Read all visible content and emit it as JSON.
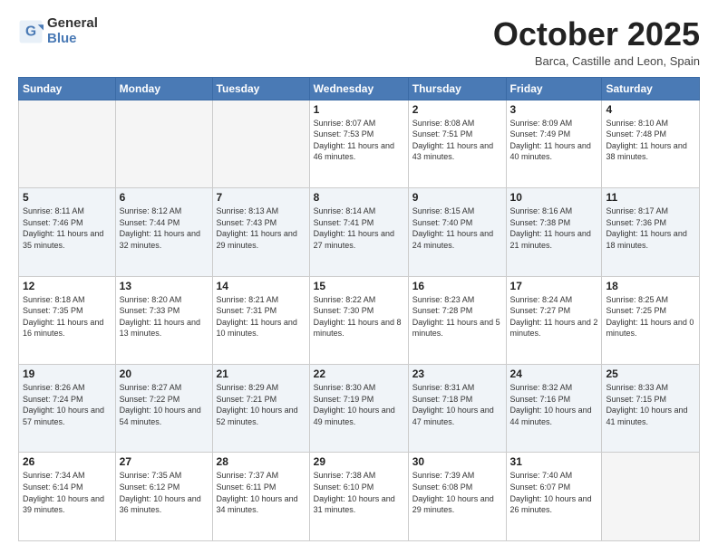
{
  "logo": {
    "general": "General",
    "blue": "Blue"
  },
  "title": "October 2025",
  "subtitle": "Barca, Castille and Leon, Spain",
  "headers": [
    "Sunday",
    "Monday",
    "Tuesday",
    "Wednesday",
    "Thursday",
    "Friday",
    "Saturday"
  ],
  "weeks": [
    [
      {
        "day": "",
        "info": ""
      },
      {
        "day": "",
        "info": ""
      },
      {
        "day": "",
        "info": ""
      },
      {
        "day": "1",
        "info": "Sunrise: 8:07 AM\nSunset: 7:53 PM\nDaylight: 11 hours and 46 minutes."
      },
      {
        "day": "2",
        "info": "Sunrise: 8:08 AM\nSunset: 7:51 PM\nDaylight: 11 hours and 43 minutes."
      },
      {
        "day": "3",
        "info": "Sunrise: 8:09 AM\nSunset: 7:49 PM\nDaylight: 11 hours and 40 minutes."
      },
      {
        "day": "4",
        "info": "Sunrise: 8:10 AM\nSunset: 7:48 PM\nDaylight: 11 hours and 38 minutes."
      }
    ],
    [
      {
        "day": "5",
        "info": "Sunrise: 8:11 AM\nSunset: 7:46 PM\nDaylight: 11 hours and 35 minutes."
      },
      {
        "day": "6",
        "info": "Sunrise: 8:12 AM\nSunset: 7:44 PM\nDaylight: 11 hours and 32 minutes."
      },
      {
        "day": "7",
        "info": "Sunrise: 8:13 AM\nSunset: 7:43 PM\nDaylight: 11 hours and 29 minutes."
      },
      {
        "day": "8",
        "info": "Sunrise: 8:14 AM\nSunset: 7:41 PM\nDaylight: 11 hours and 27 minutes."
      },
      {
        "day": "9",
        "info": "Sunrise: 8:15 AM\nSunset: 7:40 PM\nDaylight: 11 hours and 24 minutes."
      },
      {
        "day": "10",
        "info": "Sunrise: 8:16 AM\nSunset: 7:38 PM\nDaylight: 11 hours and 21 minutes."
      },
      {
        "day": "11",
        "info": "Sunrise: 8:17 AM\nSunset: 7:36 PM\nDaylight: 11 hours and 18 minutes."
      }
    ],
    [
      {
        "day": "12",
        "info": "Sunrise: 8:18 AM\nSunset: 7:35 PM\nDaylight: 11 hours and 16 minutes."
      },
      {
        "day": "13",
        "info": "Sunrise: 8:20 AM\nSunset: 7:33 PM\nDaylight: 11 hours and 13 minutes."
      },
      {
        "day": "14",
        "info": "Sunrise: 8:21 AM\nSunset: 7:31 PM\nDaylight: 11 hours and 10 minutes."
      },
      {
        "day": "15",
        "info": "Sunrise: 8:22 AM\nSunset: 7:30 PM\nDaylight: 11 hours and 8 minutes."
      },
      {
        "day": "16",
        "info": "Sunrise: 8:23 AM\nSunset: 7:28 PM\nDaylight: 11 hours and 5 minutes."
      },
      {
        "day": "17",
        "info": "Sunrise: 8:24 AM\nSunset: 7:27 PM\nDaylight: 11 hours and 2 minutes."
      },
      {
        "day": "18",
        "info": "Sunrise: 8:25 AM\nSunset: 7:25 PM\nDaylight: 11 hours and 0 minutes."
      }
    ],
    [
      {
        "day": "19",
        "info": "Sunrise: 8:26 AM\nSunset: 7:24 PM\nDaylight: 10 hours and 57 minutes."
      },
      {
        "day": "20",
        "info": "Sunrise: 8:27 AM\nSunset: 7:22 PM\nDaylight: 10 hours and 54 minutes."
      },
      {
        "day": "21",
        "info": "Sunrise: 8:29 AM\nSunset: 7:21 PM\nDaylight: 10 hours and 52 minutes."
      },
      {
        "day": "22",
        "info": "Sunrise: 8:30 AM\nSunset: 7:19 PM\nDaylight: 10 hours and 49 minutes."
      },
      {
        "day": "23",
        "info": "Sunrise: 8:31 AM\nSunset: 7:18 PM\nDaylight: 10 hours and 47 minutes."
      },
      {
        "day": "24",
        "info": "Sunrise: 8:32 AM\nSunset: 7:16 PM\nDaylight: 10 hours and 44 minutes."
      },
      {
        "day": "25",
        "info": "Sunrise: 8:33 AM\nSunset: 7:15 PM\nDaylight: 10 hours and 41 minutes."
      }
    ],
    [
      {
        "day": "26",
        "info": "Sunrise: 7:34 AM\nSunset: 6:14 PM\nDaylight: 10 hours and 39 minutes."
      },
      {
        "day": "27",
        "info": "Sunrise: 7:35 AM\nSunset: 6:12 PM\nDaylight: 10 hours and 36 minutes."
      },
      {
        "day": "28",
        "info": "Sunrise: 7:37 AM\nSunset: 6:11 PM\nDaylight: 10 hours and 34 minutes."
      },
      {
        "day": "29",
        "info": "Sunrise: 7:38 AM\nSunset: 6:10 PM\nDaylight: 10 hours and 31 minutes."
      },
      {
        "day": "30",
        "info": "Sunrise: 7:39 AM\nSunset: 6:08 PM\nDaylight: 10 hours and 29 minutes."
      },
      {
        "day": "31",
        "info": "Sunrise: 7:40 AM\nSunset: 6:07 PM\nDaylight: 10 hours and 26 minutes."
      },
      {
        "day": "",
        "info": ""
      }
    ]
  ]
}
